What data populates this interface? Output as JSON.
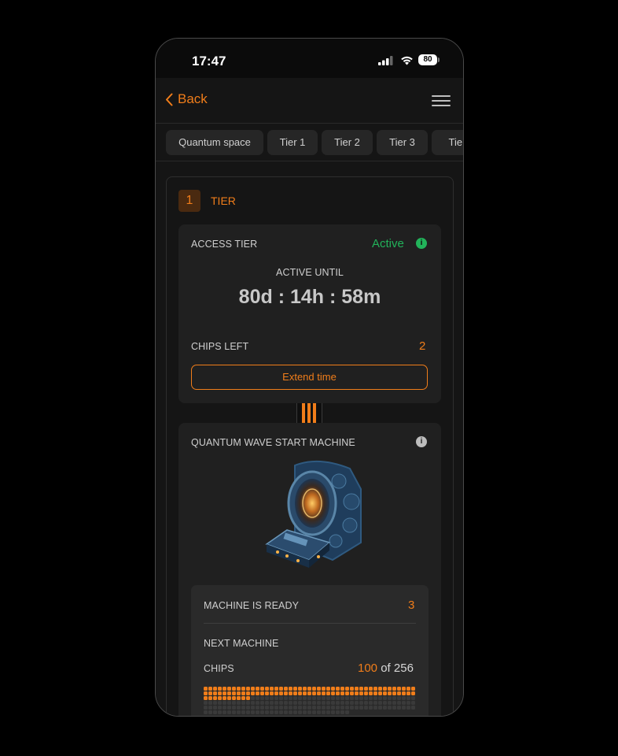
{
  "status_bar": {
    "time": "17:47",
    "battery": "80"
  },
  "nav": {
    "back_label": "Back"
  },
  "tabs": [
    "Quantum space",
    "Tier 1",
    "Tier 2",
    "Tier 3",
    "Tier"
  ],
  "tier": {
    "number": "1",
    "label": "TIER"
  },
  "access": {
    "title": "ACCESS TIER",
    "status": "Active",
    "active_until_label": "ACTIVE UNTIL",
    "countdown": "80d : 14h : 58m",
    "chips_left_label": "CHIPS LEFT",
    "chips_left_value": "2",
    "extend_button": "Extend time"
  },
  "machine": {
    "title": "QUANTUM WAVE START MACHINE",
    "ready_label": "MACHINE IS READY",
    "ready_value": "3",
    "next_label": "NEXT MACHINE",
    "chips_label": "CHIPS",
    "chips_current": "100",
    "chips_of": "of 256",
    "chips_filled": 100,
    "chips_total": 256
  },
  "colors": {
    "accent": "#f07d1a",
    "active": "#22b35a",
    "background": "#151515",
    "card": "#202020"
  }
}
